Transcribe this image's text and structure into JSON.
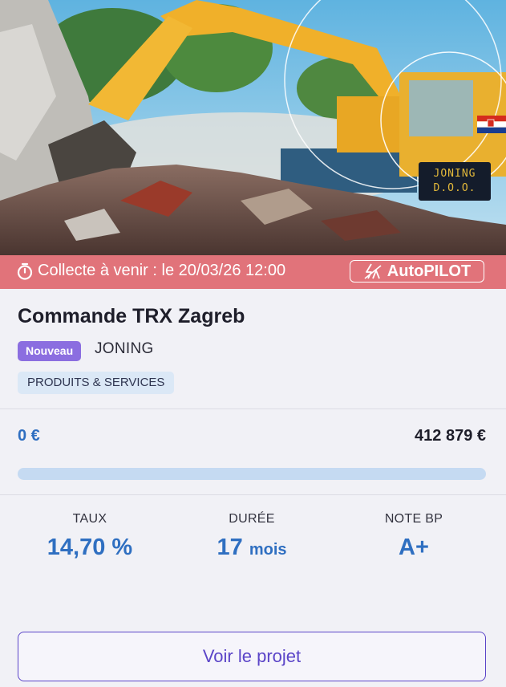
{
  "hero": {
    "logo_line1": "JONING",
    "logo_line2": "D.O.O."
  },
  "status": {
    "collecte_text": "Collecte à venir : le 20/03/26 12:00",
    "autopilot_label": "AutoPILOT"
  },
  "project": {
    "title": "Commande TRX Zagreb",
    "badge": "Nouveau",
    "company": "JONING",
    "category": "PRODUITS & SERVICES"
  },
  "funding": {
    "raised": "0 €",
    "target": "412 879 €",
    "progress_fraction": 0
  },
  "stats": {
    "taux_label": "TAUX",
    "taux_value": "14,70 %",
    "duree_label": "DURÉE",
    "duree_value": "17",
    "duree_unit": "mois",
    "note_label": "NOTE BP",
    "note_value": "A+"
  },
  "cta": {
    "label": "Voir le projet"
  },
  "colors": {
    "status_bar": "#e1737a",
    "accent_blue": "#2f6fc1",
    "badge_purple": "#8b6ee0",
    "cta_purple": "#5b45c8"
  },
  "icons": [
    "stopwatch-icon",
    "autopilot-bolt-icon",
    "croatia-flag-icon"
  ]
}
